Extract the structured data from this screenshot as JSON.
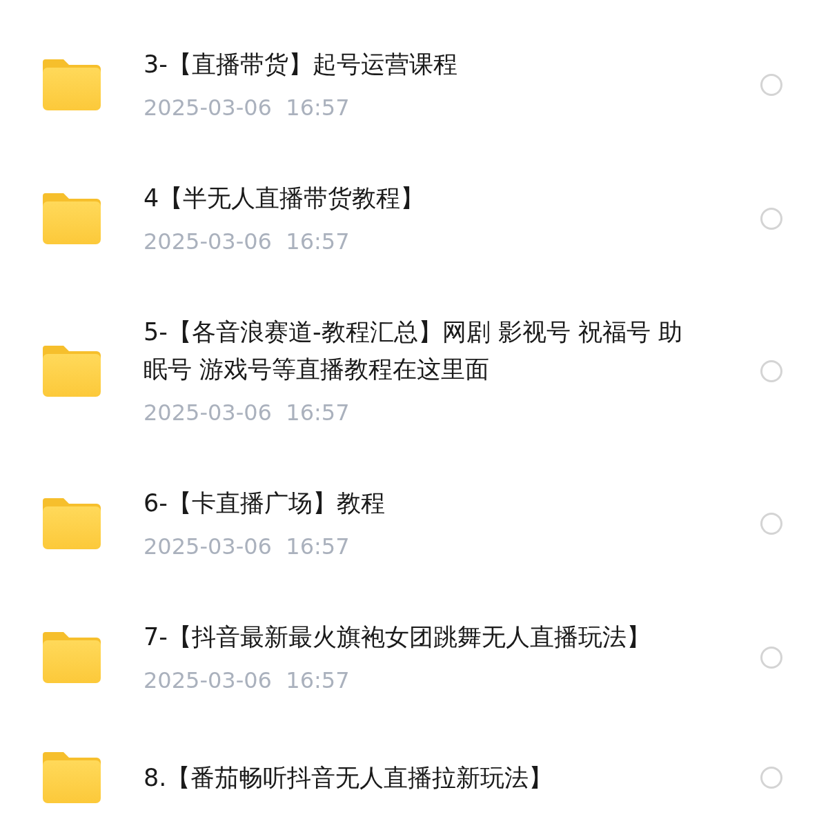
{
  "files": [
    {
      "name": "3-【直播带货】起号运营课程",
      "date": "2025-03-06  16:57",
      "selected": false
    },
    {
      "name": "4【半无人直播带货教程】",
      "date": "2025-03-06  16:57",
      "selected": false
    },
    {
      "name": "5-【各音浪赛道-教程汇总】网剧 影视号 祝福号 助眠号 游戏号等直播教程在这里面",
      "date": "2025-03-06  16:57",
      "selected": false
    },
    {
      "name": "6-【卡直播广场】教程",
      "date": "2025-03-06  16:57",
      "selected": false
    },
    {
      "name": "7-【抖音最新最火旗袍女团跳舞无人直播玩法】",
      "date": "2025-03-06  16:57",
      "selected": false
    },
    {
      "name": "8.【番茄畅听抖音无人直播拉新玩法】",
      "selected": false
    }
  ]
}
